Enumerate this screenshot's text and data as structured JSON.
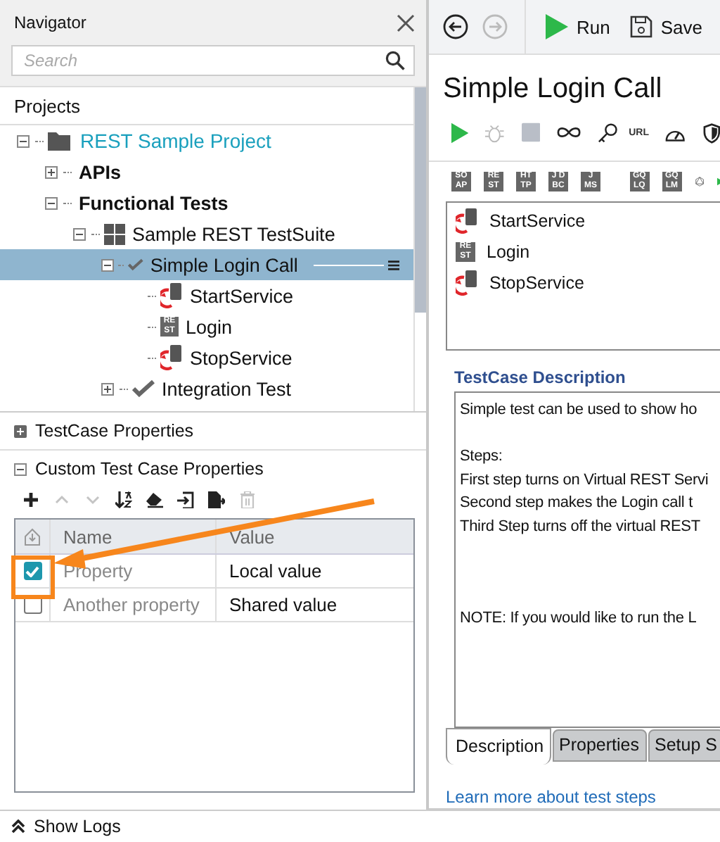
{
  "navigator": {
    "title": "Navigator",
    "search": {
      "placeholder": "Search"
    },
    "section": "Projects",
    "tree": [
      {
        "label": "REST Sample Project",
        "kind": "project",
        "expanded": true,
        "selected": false,
        "children": [
          {
            "label": "APIs",
            "kind": "folder",
            "expanded": false,
            "selected": false
          },
          {
            "label": "Functional Tests",
            "kind": "folder",
            "expanded": true,
            "selected": false,
            "children": [
              {
                "label": "Sample REST TestSuite",
                "kind": "suite",
                "expanded": true,
                "selected": false,
                "children": [
                  {
                    "label": "Simple Login Call",
                    "kind": "testcase",
                    "expanded": true,
                    "selected": true,
                    "children": [
                      {
                        "label": "StartService",
                        "kind": "virt",
                        "selected": false
                      },
                      {
                        "label": "Login",
                        "kind": "rest",
                        "icon_text": [
                          "RE",
                          "ST"
                        ],
                        "selected": false
                      },
                      {
                        "label": "StopService",
                        "kind": "virt",
                        "selected": false
                      }
                    ]
                  },
                  {
                    "label": "Integration Test",
                    "kind": "testcase",
                    "expanded": false,
                    "selected": false
                  }
                ]
              }
            ]
          }
        ]
      }
    ]
  },
  "properties": {
    "sections": [
      {
        "title": "TestCase Properties",
        "expanded": false
      },
      {
        "title": "Custom Test Case Properties",
        "expanded": true
      }
    ],
    "toolbar": [
      {
        "kind": "add",
        "disabled": false
      },
      {
        "kind": "up",
        "disabled": true
      },
      {
        "kind": "down",
        "disabled": true
      },
      {
        "kind": "sort",
        "disabled": false
      },
      {
        "kind": "clear",
        "disabled": false
      },
      {
        "kind": "import",
        "disabled": false
      },
      {
        "kind": "export",
        "disabled": false
      },
      {
        "kind": "delete",
        "disabled": true
      }
    ],
    "columns": [
      "Name",
      "Value"
    ],
    "rows": [
      {
        "checked": true,
        "name": "Property",
        "value": "Local value"
      },
      {
        "checked": false,
        "name": "Another property",
        "value": "Shared value"
      }
    ]
  },
  "show_logs": "Show Logs",
  "editor": {
    "toolbar": {
      "run": "Run",
      "save": "Save"
    },
    "title": "Simple Login Call",
    "url_label": "URL",
    "step_types": [
      [
        "SO",
        "AP"
      ],
      [
        "RE",
        "ST"
      ],
      [
        "HT",
        "TP"
      ],
      [
        "J D",
        "BC"
      ],
      [
        "J",
        "MS"
      ],
      [
        "GQ",
        "LQ"
      ],
      [
        "GQ",
        "LM"
      ]
    ],
    "steps": [
      {
        "label": "StartService",
        "kind": "virt"
      },
      {
        "label": "Login",
        "kind": "rest",
        "icon_text": [
          "RE",
          "ST"
        ]
      },
      {
        "label": "StopService",
        "kind": "virt"
      }
    ],
    "description_title": "TestCase Description",
    "description": [
      [
        "Simple test can be used to show ho"
      ],
      [
        "Steps:",
        "First step turns on Virtual REST Servi",
        "Second step makes the Login call t",
        "Third Step turns off the virtual REST"
      ],
      [
        "NOTE: If you would like to run the L"
      ]
    ],
    "tabs": [
      {
        "label": "Description",
        "selected": true
      },
      {
        "label": "Properties",
        "selected": false
      },
      {
        "label": "Setup S",
        "selected": false
      }
    ],
    "link": "Learn more about test steps"
  }
}
